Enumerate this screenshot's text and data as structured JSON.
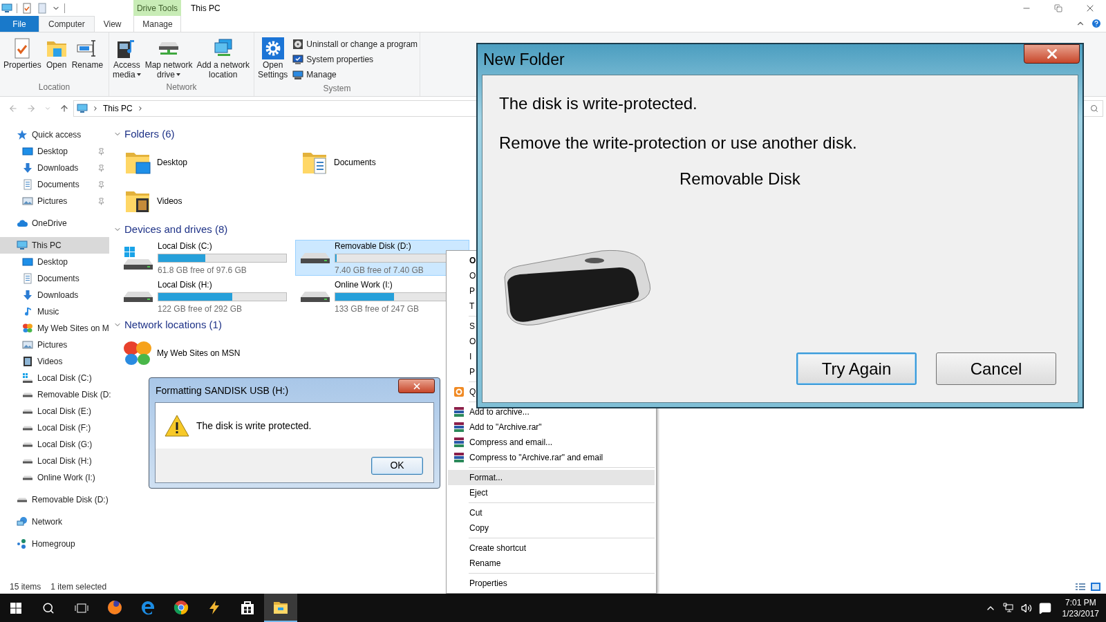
{
  "title_bar": {
    "title": "This PC",
    "contextual_group": "Drive Tools"
  },
  "ribbon_tabs": [
    {
      "label": "File",
      "kind": "file",
      "selected": false
    },
    {
      "label": "Computer",
      "kind": "tab",
      "selected": true
    },
    {
      "label": "View",
      "kind": "tab",
      "selected": false
    },
    {
      "label": "Manage",
      "kind": "contextual",
      "selected": false
    }
  ],
  "ribbon_groups": [
    {
      "label": "Location",
      "buttons": [
        {
          "kind": "large",
          "lines": [
            "Properties"
          ],
          "dropdown": false
        },
        {
          "kind": "large",
          "lines": [
            "Open"
          ],
          "dropdown": false
        },
        {
          "kind": "large",
          "lines": [
            "Rename"
          ],
          "dropdown": false
        }
      ]
    },
    {
      "label": "Network",
      "buttons": [
        {
          "kind": "large",
          "lines": [
            "Access",
            "media"
          ],
          "dropdown": true
        },
        {
          "kind": "large",
          "lines": [
            "Map network",
            "drive"
          ],
          "dropdown": true
        },
        {
          "kind": "large",
          "lines": [
            "Add a network",
            "location"
          ],
          "dropdown": false
        }
      ]
    },
    {
      "label": "System",
      "buttons": [
        {
          "kind": "large",
          "lines": [
            "Open",
            "Settings"
          ],
          "dropdown": false
        },
        {
          "kind": "small",
          "lines": [
            "Uninstall or change a program"
          ]
        },
        {
          "kind": "small",
          "lines": [
            "System properties"
          ]
        },
        {
          "kind": "small",
          "lines": [
            "Manage"
          ]
        }
      ]
    }
  ],
  "address_bar": {
    "path": [
      "This PC"
    ]
  },
  "sidebar": {
    "items": [
      {
        "label": "Quick access",
        "kind": "star",
        "selected": false,
        "children": [
          {
            "label": "Desktop",
            "kind": "desktop",
            "pinned": true,
            "selected": false
          },
          {
            "label": "Downloads",
            "kind": "downloads",
            "pinned": true,
            "selected": false
          },
          {
            "label": "Documents",
            "kind": "documents",
            "pinned": true,
            "selected": false
          },
          {
            "label": "Pictures",
            "kind": "pictures",
            "pinned": true,
            "selected": false
          }
        ]
      },
      {
        "label": "OneDrive",
        "kind": "cloud",
        "selected": false
      },
      {
        "label": "This PC",
        "kind": "pc",
        "selected": true,
        "children": [
          {
            "label": "Desktop",
            "kind": "desktop",
            "selected": false
          },
          {
            "label": "Documents",
            "kind": "documents",
            "selected": false
          },
          {
            "label": "Downloads",
            "kind": "downloads",
            "selected": false
          },
          {
            "label": "Music",
            "kind": "music",
            "selected": false
          },
          {
            "label": "My Web Sites on M",
            "kind": "web",
            "selected": false
          },
          {
            "label": "Pictures",
            "kind": "pictures",
            "selected": false
          },
          {
            "label": "Videos",
            "kind": "videos",
            "selected": false
          },
          {
            "label": "Local Disk (C:)",
            "kind": "systemdrive",
            "selected": false
          },
          {
            "label": "Removable Disk (D:",
            "kind": "drive",
            "selected": false
          },
          {
            "label": "Local Disk (E:)",
            "kind": "drive",
            "selected": false
          },
          {
            "label": "Local Disk (F:)",
            "kind": "drive",
            "selected": false
          },
          {
            "label": "Local Disk (G:)",
            "kind": "drive",
            "selected": false
          },
          {
            "label": "Local Disk (H:)",
            "kind": "drive",
            "selected": false
          },
          {
            "label": "Online Work (I:)",
            "kind": "drive",
            "selected": false
          }
        ]
      },
      {
        "label": "Removable Disk (D:)",
        "kind": "drive",
        "selected": false
      },
      {
        "label": "Network",
        "kind": "network",
        "selected": false
      },
      {
        "label": "Homegroup",
        "kind": "homegroup",
        "selected": false
      }
    ]
  },
  "sections": [
    {
      "title": "Folders (6)",
      "kind": "folders",
      "expanded": true,
      "items": [
        {
          "name": "Desktop",
          "kind": "desktop"
        },
        {
          "name": "Documents",
          "kind": "documents"
        },
        {
          "name": "Videos",
          "kind": "videos"
        }
      ]
    },
    {
      "title": "Devices and drives (8)",
      "kind": "drives",
      "expanded": true,
      "items": [
        {
          "name": "Local Disk (C:)",
          "kind": "systemdrive",
          "free": "61.8 GB free of 97.6 GB",
          "level": 0.37,
          "selected": false
        },
        {
          "name": "Removable Disk (D:)",
          "kind": "drive",
          "free": "7.40 GB free of 7.40 GB",
          "level": 0.01,
          "selected": true
        },
        {
          "name": "Local Disk (H:)",
          "kind": "drive",
          "free": "122 GB free of 292 GB",
          "level": 0.58,
          "selected": false
        },
        {
          "name": "Online Work (I:)",
          "kind": "drive",
          "free": "133 GB free of 247 GB",
          "level": 0.46,
          "selected": false
        }
      ]
    },
    {
      "title": "Network locations (1)",
      "kind": "folders",
      "expanded": true,
      "items": [
        {
          "name": "My Web Sites on MSN",
          "kind": "web"
        }
      ]
    }
  ],
  "status_bar": {
    "item_count": "15 items",
    "selection": "1 item selected"
  },
  "context_menu": {
    "groups": [
      {
        "items": [
          {
            "label": "O",
            "kind": "plain",
            "bold": true,
            "selected": false
          },
          {
            "label": "O",
            "kind": "plain",
            "bold": false,
            "selected": false
          },
          {
            "label": "P",
            "kind": "plain",
            "bold": false,
            "selected": false
          },
          {
            "label": "T",
            "kind": "plain",
            "bold": false,
            "selected": false
          }
        ]
      },
      {
        "items": [
          {
            "label": "S",
            "kind": "plain",
            "bold": false,
            "selected": false
          },
          {
            "label": "O",
            "kind": "plain",
            "bold": false,
            "selected": false
          },
          {
            "label": "I",
            "kind": "plain",
            "bold": false,
            "selected": false
          },
          {
            "label": "P",
            "kind": "plain",
            "bold": false,
            "selected": false
          }
        ]
      },
      {
        "items": [
          {
            "label": "Q",
            "kind": "quick",
            "bold": false,
            "selected": false
          }
        ]
      },
      {
        "items": [
          {
            "label": "Add to archive...",
            "kind": "archive",
            "bold": false,
            "selected": false
          },
          {
            "label": "Add to \"Archive.rar\"",
            "kind": "archive",
            "bold": false,
            "selected": false
          },
          {
            "label": "Compress and email...",
            "kind": "archive",
            "bold": false,
            "selected": false
          },
          {
            "label": "Compress to \"Archive.rar\" and email",
            "kind": "archive",
            "bold": false,
            "selected": false
          }
        ]
      },
      {
        "items": [
          {
            "label": "Format...",
            "kind": "plain",
            "bold": false,
            "selected": true
          },
          {
            "label": "Eject",
            "kind": "plain",
            "bold": false,
            "selected": false
          }
        ]
      },
      {
        "items": [
          {
            "label": "Cut",
            "kind": "plain",
            "bold": false,
            "selected": false
          },
          {
            "label": "Copy",
            "kind": "plain",
            "bold": false,
            "selected": false
          }
        ]
      },
      {
        "items": [
          {
            "label": "Create shortcut",
            "kind": "plain",
            "bold": false,
            "selected": false
          },
          {
            "label": "Rename",
            "kind": "plain",
            "bold": false,
            "selected": false
          }
        ]
      },
      {
        "items": [
          {
            "label": "Properties",
            "kind": "plain",
            "bold": false,
            "selected": false
          }
        ]
      }
    ]
  },
  "new_folder_dialog": {
    "title": "New Folder",
    "message": "The disk is write-protected.",
    "detail": "Remove the write-protection or use another disk.",
    "drive_name": "Removable Disk",
    "buttons": [
      {
        "label": "Try Again",
        "focused": true
      },
      {
        "label": "Cancel",
        "focused": false
      }
    ]
  },
  "format_dialog": {
    "title": "Formatting SANDISK USB (H:)",
    "message": "The disk is write protected.",
    "buttons": [
      {
        "label": "OK",
        "focused": true
      }
    ]
  },
  "taskbar": {
    "apps": [
      {
        "kind": "firefox",
        "active": false
      },
      {
        "kind": "edge",
        "active": false
      },
      {
        "kind": "chrome",
        "active": false
      },
      {
        "kind": "pen",
        "active": false
      },
      {
        "kind": "store",
        "active": false
      },
      {
        "kind": "explorer",
        "active": true
      }
    ],
    "time": "7:01 PM",
    "date": "1/23/2017"
  }
}
